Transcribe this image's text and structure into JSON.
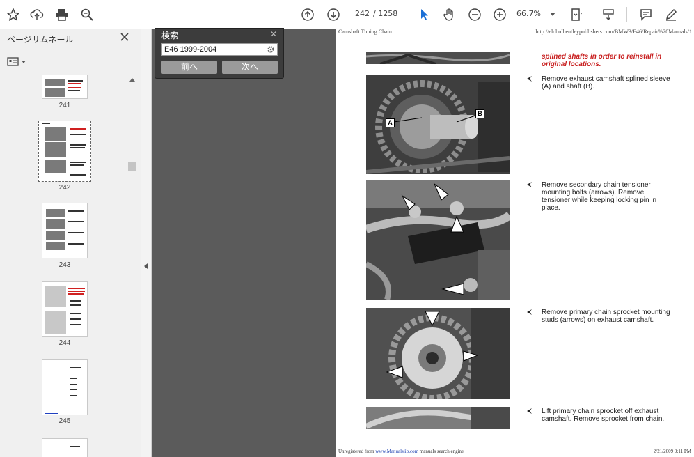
{
  "toolbar": {
    "page_current": "242",
    "page_total": "/ 1258",
    "zoom": "66.7%"
  },
  "sidebar": {
    "title": "ページサムネール",
    "thumbnails": [
      {
        "label": "241"
      },
      {
        "label": "242"
      },
      {
        "label": "243"
      },
      {
        "label": "244"
      },
      {
        "label": "245"
      }
    ]
  },
  "search": {
    "title": "検索",
    "value": "E46 1999-2004",
    "prev": "前へ",
    "next": "次へ"
  },
  "document": {
    "header_left": "Camshaft Timing Chain",
    "header_right": "http://elobolbentleypublishers.com/BMW3/E46/Repair%20Manuals/1",
    "note_red": "splined shafts in order to reinstall in original locations.",
    "labels": {
      "a": "A",
      "b": "B"
    },
    "steps": [
      "Remove exhaust camshaft splined sleeve (A) and shaft (B).",
      "Remove secondary chain tensioner mounting bolts (arrows). Remove tensioner while keeping locking pin in place.",
      "Remove primary chain sprocket mounting studs (arrows) on exhaust camshaft.",
      "Lift primary chain sprocket off exhaust camshaft. Remove sprocket from chain."
    ],
    "footer_left_pre": "Unregistered from",
    "footer_link": "www.Manualslib.com",
    "footer_left_post": "manuals search engine",
    "footer_right": "2/21/2009 9:11 PM"
  }
}
